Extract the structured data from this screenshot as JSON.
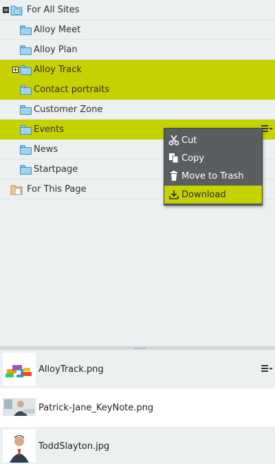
{
  "tree": {
    "root": {
      "label": "For All Sites"
    },
    "items": [
      {
        "label": "Alloy Meet"
      },
      {
        "label": "Alloy Plan"
      },
      {
        "label": "Alloy Track"
      },
      {
        "label": "Contact portraits"
      },
      {
        "label": "Customer Zone"
      },
      {
        "label": "Events"
      },
      {
        "label": "News"
      },
      {
        "label": "Startpage"
      }
    ],
    "page_root": {
      "label": "For This Page"
    }
  },
  "context_menu": {
    "items": [
      {
        "label": "Cut",
        "icon": "scissors-icon"
      },
      {
        "label": "Copy",
        "icon": "copy-icon"
      },
      {
        "label": "Move to Trash",
        "icon": "trash-icon"
      },
      {
        "label": "Download",
        "icon": "download-icon"
      }
    ]
  },
  "assets": [
    {
      "name": "AlloyTrack.png"
    },
    {
      "name": "Patrick-Jane_KeyNote.png"
    },
    {
      "name": "ToddSlayton.jpg"
    }
  ],
  "colors": {
    "selection": "#c6d200",
    "background": "#ecf0f1",
    "menu_bg": "#5b5e61"
  }
}
